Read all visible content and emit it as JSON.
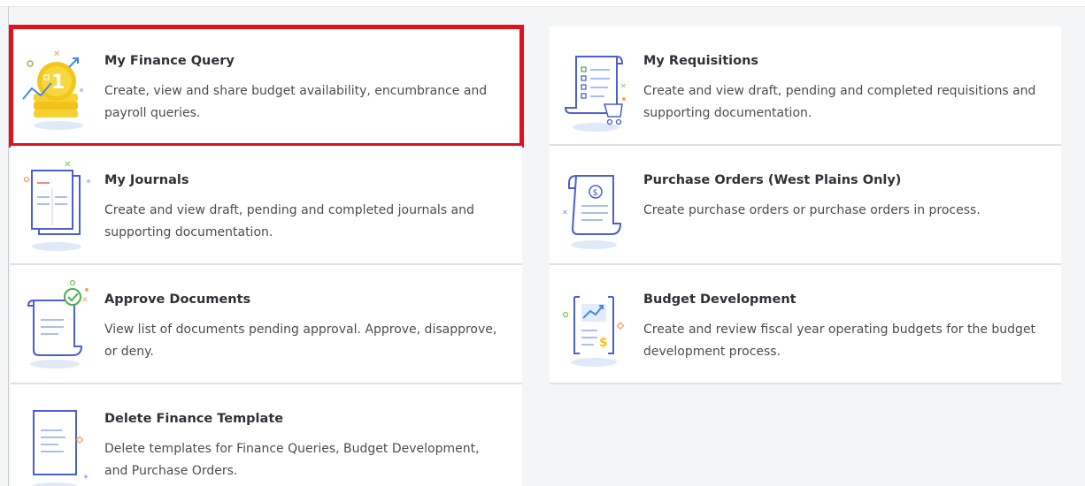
{
  "left_cards": [
    {
      "title": "My Finance Query",
      "description": "Create, view and share budget availability, encumbrance and payroll queries.",
      "icon": "finance-coins-icon",
      "highlighted": true
    },
    {
      "title": "My Journals",
      "description": "Create and view draft, pending and completed journals and supporting documentation.",
      "icon": "journal-icon",
      "highlighted": false
    },
    {
      "title": "Approve Documents",
      "description": "View list of documents pending approval. Approve, disapprove, or deny.",
      "icon": "approve-document-icon",
      "highlighted": false
    },
    {
      "title": "Delete Finance Template",
      "description": "Delete templates for Finance Queries, Budget Development, and Purchase Orders.",
      "icon": "template-icon",
      "highlighted": false
    }
  ],
  "right_cards": [
    {
      "title": "My Requisitions",
      "description": "Create and view draft, pending and completed requisitions and supporting documentation.",
      "icon": "requisition-icon",
      "highlighted": false
    },
    {
      "title": "Purchase Orders (West Plains Only)",
      "description": "Create purchase orders or purchase orders in process.",
      "icon": "purchase-order-icon",
      "highlighted": false
    },
    {
      "title": "Budget Development",
      "description": "Create and review fiscal year operating budgets for the budget development process.",
      "icon": "budget-chart-icon",
      "highlighted": false
    }
  ],
  "colors": {
    "highlight": "#e0121d",
    "icon_blue": "#4a5fd1",
    "icon_gold": "#f5c518",
    "icon_green": "#4caf50",
    "card_bg": "#ffffff",
    "page_bg": "#f4f5f6"
  }
}
